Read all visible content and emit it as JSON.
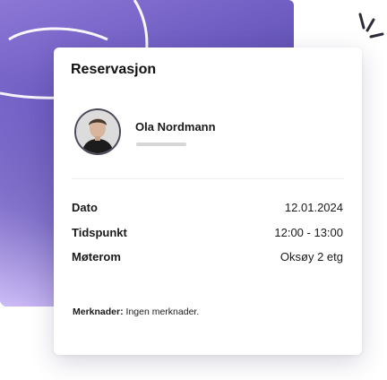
{
  "card": {
    "title": "Reservasjon"
  },
  "user": {
    "name": "Ola Nordmann"
  },
  "details": [
    {
      "label": "Dato",
      "value": "12.01.2024"
    },
    {
      "label": "Tidspunkt",
      "value": "12:00 - 13:00"
    },
    {
      "label": "Møterom",
      "value": "Oksøy 2 etg"
    }
  ],
  "notes": {
    "label": "Merknader:",
    "value": "Ingen merknader."
  },
  "colors": {
    "panel_top": "#8c77d6",
    "panel_dark": "#2f2a5e",
    "panel_light": "#d6c4ff",
    "text": "#111111",
    "accent_dark": "#2b2b3a"
  },
  "icons": {
    "avatar": "person-avatar",
    "decoration": "sparkle-lines-icon"
  }
}
